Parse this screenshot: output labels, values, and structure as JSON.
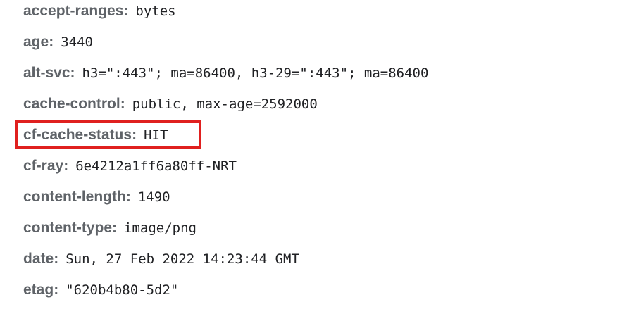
{
  "response_headers": [
    {
      "name": "accept-ranges",
      "value": "bytes"
    },
    {
      "name": "age",
      "value": "3440"
    },
    {
      "name": "alt-svc",
      "value": "h3=\":443\"; ma=86400, h3-29=\":443\"; ma=86400"
    },
    {
      "name": "cache-control",
      "value": "public, max-age=2592000"
    },
    {
      "name": "cf-cache-status",
      "value": "HIT"
    },
    {
      "name": "cf-ray",
      "value": "6e4212a1ff6a80ff-NRT"
    },
    {
      "name": "content-length",
      "value": "1490"
    },
    {
      "name": "content-type",
      "value": "image/png"
    },
    {
      "name": "date",
      "value": "Sun, 27 Feb 2022 14:23:44 GMT"
    },
    {
      "name": "etag",
      "value": "\"620b4b80-5d2\""
    }
  ],
  "separator": ":",
  "highlight": {
    "row_name": "cf-cache-status",
    "color": "#e0201f"
  }
}
